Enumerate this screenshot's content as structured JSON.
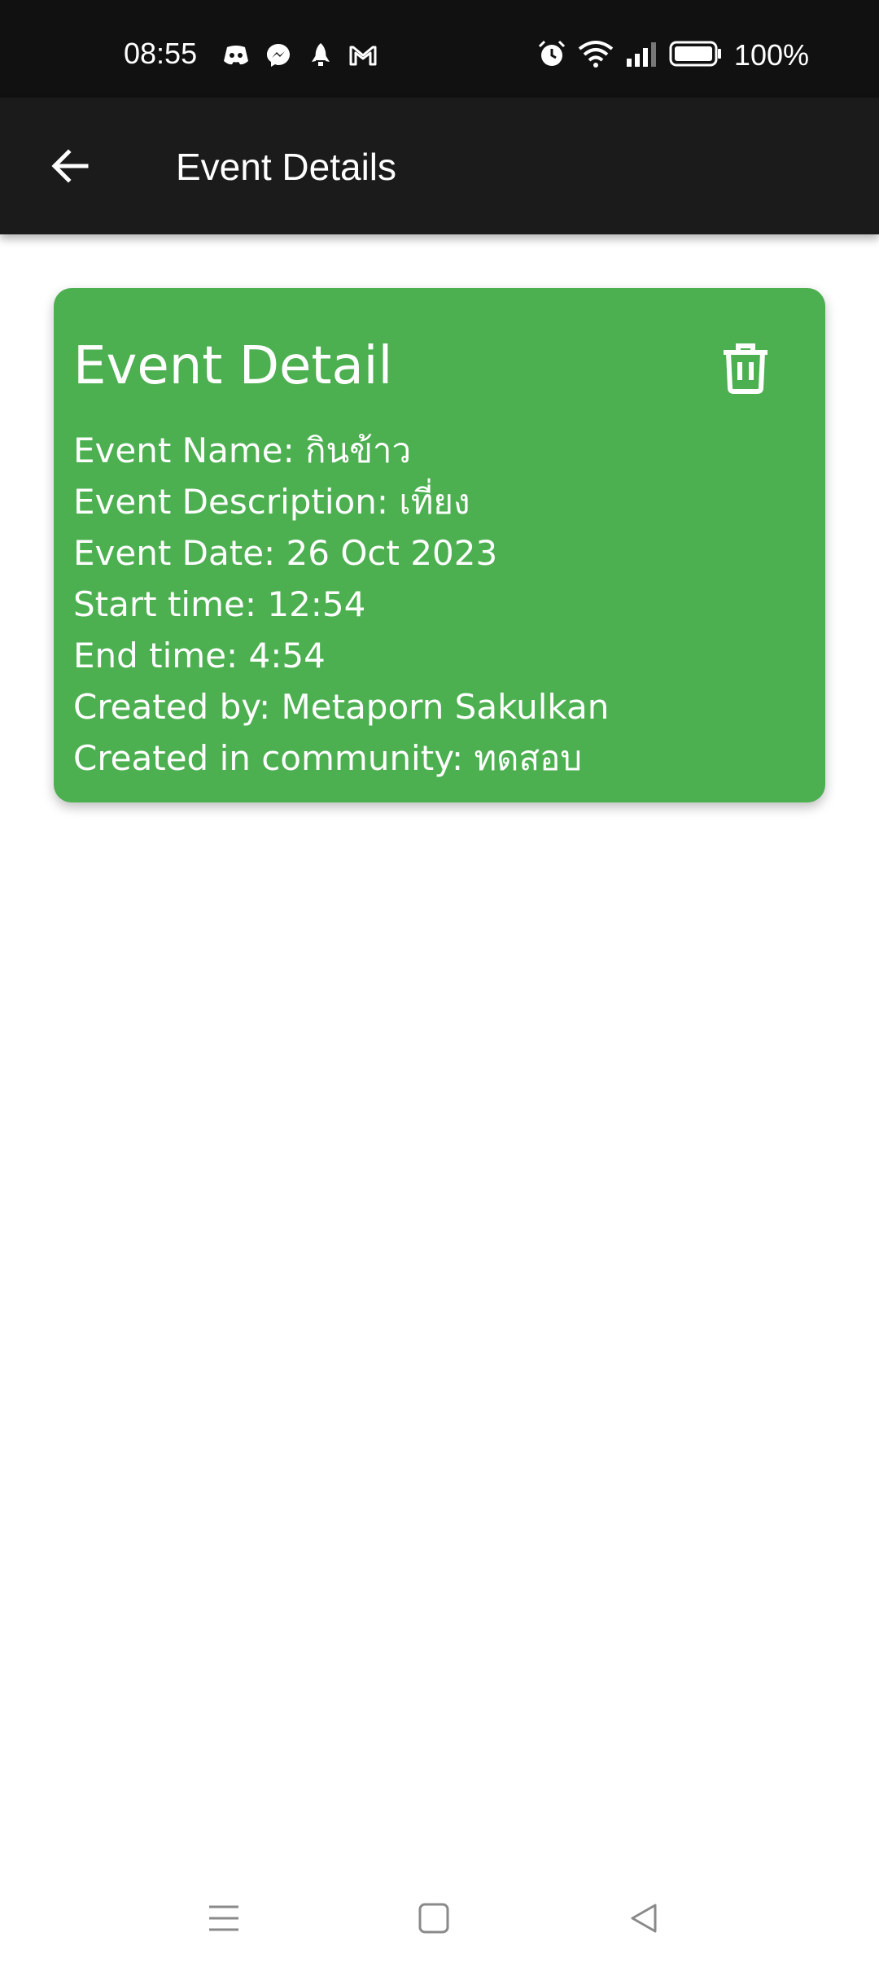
{
  "status_bar": {
    "time": "08:55",
    "notification_icons": [
      "discord-icon",
      "messenger-icon",
      "rocket-icon",
      "gmail-icon"
    ],
    "system_icons": [
      "alarm-icon",
      "wifi-icon",
      "signal-icon",
      "battery-icon"
    ],
    "battery_level": "100%"
  },
  "app_bar": {
    "title": "Event Details",
    "back_icon": "arrow-back-icon",
    "background": "#1b1b1b"
  },
  "card": {
    "title": "Event Detail",
    "delete_icon": "trash-icon",
    "background": "#4caf50",
    "details": {
      "event_name": "Event Name: กินข้าว",
      "event_description": "Event Description: เที่ยง",
      "event_date": "Event Date: 26 Oct 2023",
      "start_time": "Start time: 12:54",
      "end_time": "End time: 4:54",
      "created_by": "Created by: Metaporn Sakulkan",
      "created_in": "Created in community: ทดสอบ"
    }
  },
  "nav_bar": {
    "buttons": [
      "menu-icon",
      "home-square-icon",
      "back-triangle-icon"
    ]
  }
}
